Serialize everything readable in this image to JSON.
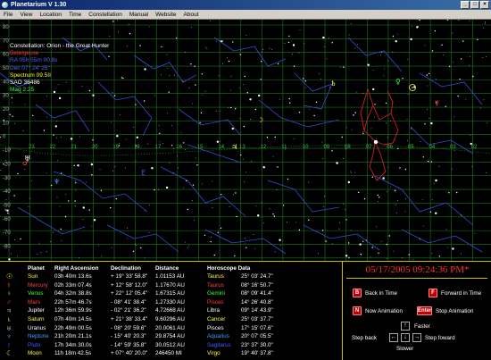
{
  "window": {
    "title": "Planetarium V 1.30",
    "buttons": [
      "_",
      "□",
      "×"
    ]
  },
  "menu": [
    "File",
    "View",
    "Location",
    "Time",
    "Constellation",
    "Manual",
    "Website",
    "About"
  ],
  "overlay": {
    "constellation": "Constellation: Orion - the Great Hunter",
    "star_name": "Betelgeuse",
    "ra": "RA    05h 55m 00.8s",
    "dec": "Dec    07° 24' 25\"",
    "spectrum": "Spectrum  09.5II",
    "sao": "SAO 36486",
    "mag": "Mag 2.25"
  },
  "colors": {
    "grid": "#1c7a1c",
    "constellation_lines": "#3050d8",
    "orion_lines": "#d02020",
    "header_rule": "#c8c000",
    "datetime": "#ff3030"
  },
  "ra_labels": [
    "23",
    "22",
    "21",
    "20",
    "19",
    "18",
    "17",
    "16",
    "15",
    "14",
    "13",
    "12",
    "11",
    "10",
    "09",
    "08",
    "07",
    "06",
    "05",
    "04",
    "03",
    "02",
    "01"
  ],
  "dec_labels": [
    "80",
    "70",
    "60",
    "50",
    "40",
    "30",
    "20",
    "10",
    "0",
    "-10",
    "-20",
    "-30",
    "-40",
    "-50",
    "-60",
    "-70",
    "-80"
  ],
  "table": {
    "headers": {
      "planet": "Planet",
      "ra": "Right Ascension",
      "dec": "Declination",
      "dist": "Distance",
      "horo": "Horoscope Data"
    },
    "rows": [
      {
        "glyph": "☉",
        "name": "Sun",
        "ra": "03h 40m 13.6s",
        "dec": "+ 19° 33' 58.8\"",
        "dist": "1.01153 AU",
        "sign": "Taurus",
        "deg": "25° 03' 24.7\"",
        "color": "#ffff40"
      },
      {
        "glyph": "☿",
        "name": "Mercury",
        "ra": "02h 33m 07.4s",
        "dec": "+ 12° 58' 12.0\"",
        "dist": "1.17670 AU",
        "sign": "Taurus",
        "deg": "08° 16' 50.7\"",
        "color": "#ff4040"
      },
      {
        "glyph": "♀",
        "name": "Venus",
        "ra": "04h 32m 38.8s",
        "dec": "+ 22° 12' 05.4\"",
        "dist": "1.67315 AU",
        "sign": "Gemini",
        "deg": "08° 09' 41.4\"",
        "color": "#40ff40"
      },
      {
        "glyph": "♂",
        "name": "Mars",
        "ra": "22h 57m 46.7s",
        "dec": "- 08° 41' 38.4\"",
        "dist": "1.27330 AU",
        "sign": "Pisces",
        "deg": "14° 26' 40.8\"",
        "color": "#ff4040"
      },
      {
        "glyph": "♃",
        "name": "Jupiter",
        "ra": "12h 36m 59.9s",
        "dec": "- 02° 21' 36.2\"",
        "dist": "4.72668 AU",
        "sign": "Libra",
        "deg": "09° 14' 43.9\"",
        "color": "#ffffff"
      },
      {
        "glyph": "♄",
        "name": "Saturn",
        "ra": "07h 40m 14.5s",
        "dec": "+ 21° 38' 33.4\"",
        "dist": "9.60296 AU",
        "sign": "Cancer",
        "deg": "25° 03' 37.7\"",
        "color": "#ffff40"
      },
      {
        "glyph": "♅",
        "name": "Uranus",
        "ra": "22h 49m 00.5s",
        "dec": "- 08° 20' 59.6\"",
        "dist": "20.0061 AU",
        "sign": "Pisces",
        "deg": "17° 15' 07.6\"",
        "color": "#ffffff"
      },
      {
        "glyph": "♆",
        "name": "Neptune",
        "ra": "21h 20m 21.1s",
        "dec": "- 15° 40' 20.3\"",
        "dist": "29.8754 AU",
        "sign": "Aquarius",
        "deg": "20° 07' 05.5\"",
        "color": "#40a0ff"
      },
      {
        "glyph": "♇",
        "name": "Pluto",
        "ra": "17h 34m 30.0s",
        "dec": "- 14° 59' 35.8\"",
        "dist": "30.0512 AU",
        "sign": "Sagitarus",
        "deg": "23° 37' 30.0\"",
        "color": "#4060ff"
      },
      {
        "glyph": "☾",
        "name": "Moon",
        "ra": "11h 18m 42.5s",
        "dec": "+ 07° 40' 20.0\"",
        "dist": "246450 MI",
        "sign": "Virgo",
        "deg": "19° 40' 37.8\"",
        "color": "#ffff40"
      }
    ]
  },
  "controls": {
    "datetime": "05/17/2005  09:24:36 PM*",
    "key_b": "B",
    "back_in_time": "Back in Time",
    "key_f": "F",
    "forward_in_time": "Forward in Time",
    "key_n": "N",
    "now_animation": "Now Animation",
    "key_enter": "Enter",
    "stop_animation": "Stop Animation",
    "faster": "Faster",
    "slower": "Slower",
    "step_back": "Step back",
    "step_forward": "Step foward"
  }
}
